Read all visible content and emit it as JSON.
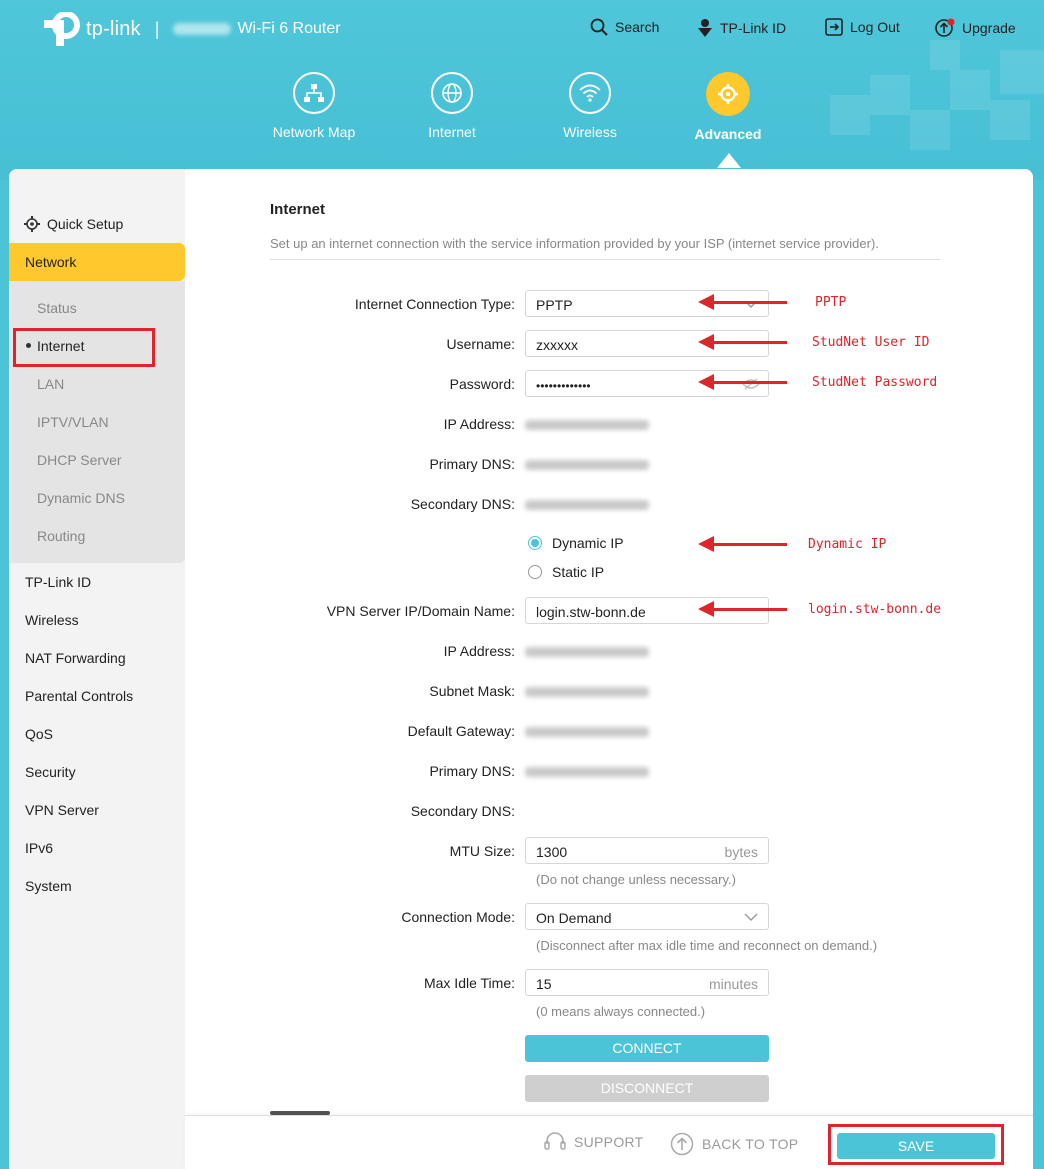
{
  "header": {
    "brand": "tp-link",
    "separator": "|",
    "product": "Wi-Fi 6 Router",
    "top_links": {
      "search": "Search",
      "tplink_id": "TP-Link ID",
      "logout": "Log Out",
      "upgrade": "Upgrade"
    },
    "main_nav": [
      {
        "label": "Network Map",
        "icon": "network-map-icon"
      },
      {
        "label": "Internet",
        "icon": "globe-icon"
      },
      {
        "label": "Wireless",
        "icon": "wifi-icon"
      },
      {
        "label": "Advanced",
        "icon": "gear-icon",
        "active": true
      }
    ]
  },
  "sidebar": {
    "quick_setup": "Quick Setup",
    "network": "Network",
    "network_sub": [
      "Status",
      "Internet",
      "LAN",
      "IPTV/VLAN",
      "DHCP Server",
      "Dynamic DNS",
      "Routing"
    ],
    "items": [
      "TP-Link ID",
      "Wireless",
      "NAT Forwarding",
      "Parental Controls",
      "QoS",
      "Security",
      "VPN Server",
      "IPv6",
      "System"
    ]
  },
  "content": {
    "title": "Internet",
    "description": "Set up an internet connection with the service information provided by your ISP (internet service provider).",
    "labels": {
      "connection_type": "Internet Connection Type:",
      "username": "Username:",
      "password": "Password:",
      "ip_address": "IP Address:",
      "primary_dns": "Primary DNS:",
      "secondary_dns": "Secondary DNS:",
      "vpn_server": "VPN Server IP/Domain Name:",
      "ip_address_2": "IP Address:",
      "subnet_mask": "Subnet Mask:",
      "default_gateway": "Default Gateway:",
      "primary_dns_2": "Primary DNS:",
      "secondary_dns_2": "Secondary DNS:",
      "mtu_size": "MTU Size:",
      "connection_mode": "Connection Mode:",
      "max_idle_time": "Max Idle Time:"
    },
    "values": {
      "connection_type": "PPTP",
      "username": "zxxxxx",
      "password": "•••••••••••••",
      "vpn_server": "login.stw-bonn.de",
      "mtu_size": "1300",
      "mtu_unit": "bytes",
      "connection_mode": "On Demand",
      "max_idle_time": "15",
      "idle_unit": "minutes"
    },
    "radio": {
      "dynamic": "Dynamic IP",
      "static": "Static IP",
      "selected": "Dynamic IP"
    },
    "hints": {
      "mtu": "(Do not change unless necessary.)",
      "mode": "(Disconnect after max idle time and reconnect on demand.)",
      "idle": "(0 means always connected.)"
    },
    "buttons": {
      "connect": "CONNECT",
      "disconnect": "DISCONNECT"
    }
  },
  "annotations": {
    "pptp": "PPTP",
    "user_id": "StudNet User ID",
    "password": "StudNet Password",
    "dynamic_ip": "Dynamic IP",
    "domain": "login.stw-bonn.de"
  },
  "footer": {
    "support": "SUPPORT",
    "back_to_top": "BACK TO TOP",
    "save": "SAVE"
  },
  "colors": {
    "accent": "#4cc4d8",
    "active": "#ffc82c",
    "annotation": "#e0242b"
  }
}
